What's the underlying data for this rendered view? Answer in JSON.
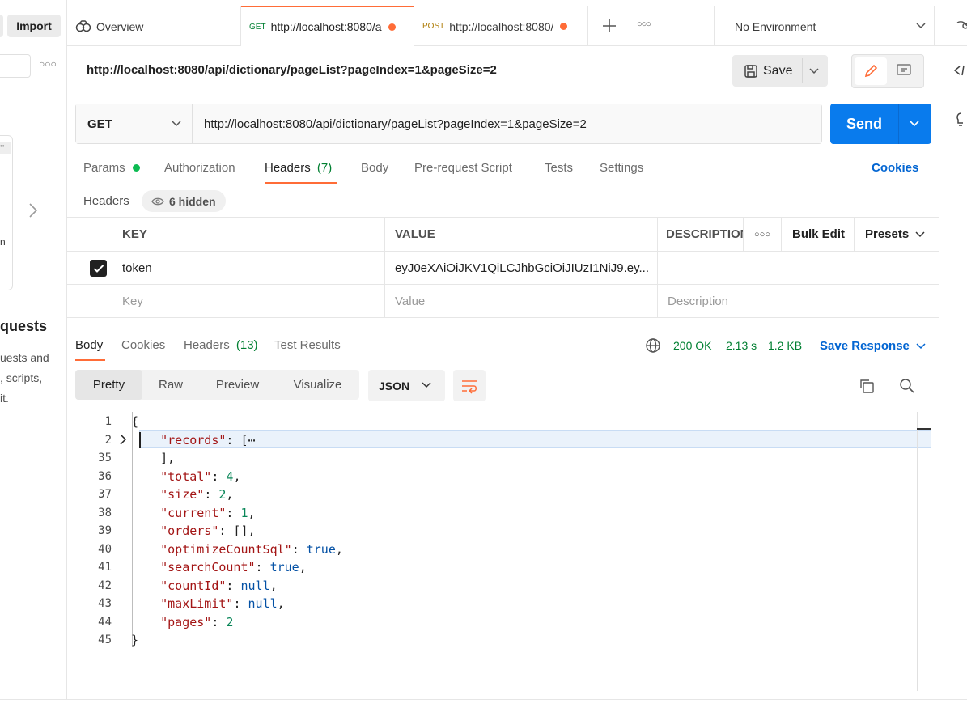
{
  "sidebar": {
    "import_label": "Import",
    "requests_heading": "quests",
    "requests_text_1": "uests and",
    "requests_text_2": ", scripts,",
    "requests_text_3": "it.",
    "stub_letter": "n"
  },
  "tabs": [
    {
      "label": "Overview",
      "icon": "overview-icon"
    },
    {
      "method": "GET",
      "label": "http://localhost:8080/a",
      "unsaved": true
    },
    {
      "method": "POST",
      "label": "http://localhost:8080/",
      "unsaved": true
    }
  ],
  "environment": {
    "selected": "No Environment"
  },
  "request": {
    "title": "http://localhost:8080/api/dictionary/pageList?pageIndex=1&pageSize=2",
    "save_label": "Save",
    "method": "GET",
    "url": "http://localhost:8080/api/dictionary/pageList?pageIndex=1&pageSize=2",
    "send_label": "Send"
  },
  "request_tabs": {
    "params": "Params",
    "authorization": "Authorization",
    "headers": "Headers",
    "headers_count": "(7)",
    "body": "Body",
    "prerequest": "Pre-request Script",
    "tests": "Tests",
    "settings": "Settings",
    "cookies": "Cookies"
  },
  "headers_section": {
    "label": "Headers",
    "hidden_label": "6 hidden",
    "col_key": "KEY",
    "col_value": "VALUE",
    "col_description": "DESCRIPTION",
    "bulk_edit": "Bulk Edit",
    "presets": "Presets",
    "rows": [
      {
        "key": "token",
        "value": "eyJ0eXAiOiJKV1QiLCJhbGciOiJIUzI1NiJ9.ey...",
        "checked": true
      }
    ],
    "placeholder_key": "Key",
    "placeholder_value": "Value",
    "placeholder_description": "Description"
  },
  "response": {
    "tabs": {
      "body": "Body",
      "cookies": "Cookies",
      "headers": "Headers",
      "headers_count": "(13)",
      "test_results": "Test Results"
    },
    "status": "200 OK",
    "time": "2.13 s",
    "size": "1.2 KB",
    "save_response": "Save Response",
    "view_modes": [
      "Pretty",
      "Raw",
      "Preview",
      "Visualize"
    ],
    "format": "JSON"
  },
  "code": {
    "lines": [
      {
        "num": "1",
        "parts": [
          [
            "p",
            "{"
          ]
        ]
      },
      {
        "num": "2",
        "parts": [
          [
            "p",
            "    "
          ],
          [
            "k",
            "\"records\""
          ],
          [
            "p",
            ": [⋯"
          ]
        ]
      },
      {
        "num": "35",
        "parts": [
          [
            "p",
            "    ],"
          ]
        ]
      },
      {
        "num": "36",
        "parts": [
          [
            "p",
            "    "
          ],
          [
            "k",
            "\"total\""
          ],
          [
            "p",
            ": "
          ],
          [
            "n",
            "4"
          ],
          [
            "p",
            ","
          ]
        ]
      },
      {
        "num": "37",
        "parts": [
          [
            "p",
            "    "
          ],
          [
            "k",
            "\"size\""
          ],
          [
            "p",
            ": "
          ],
          [
            "n",
            "2"
          ],
          [
            "p",
            ","
          ]
        ]
      },
      {
        "num": "38",
        "parts": [
          [
            "p",
            "    "
          ],
          [
            "k",
            "\"current\""
          ],
          [
            "p",
            ": "
          ],
          [
            "n",
            "1"
          ],
          [
            "p",
            ","
          ]
        ]
      },
      {
        "num": "39",
        "parts": [
          [
            "p",
            "    "
          ],
          [
            "k",
            "\"orders\""
          ],
          [
            "p",
            ": [],"
          ]
        ]
      },
      {
        "num": "40",
        "parts": [
          [
            "p",
            "    "
          ],
          [
            "k",
            "\"optimizeCountSql\""
          ],
          [
            "p",
            ": "
          ],
          [
            "b",
            "true"
          ],
          [
            "p",
            ","
          ]
        ]
      },
      {
        "num": "41",
        "parts": [
          [
            "p",
            "    "
          ],
          [
            "k",
            "\"searchCount\""
          ],
          [
            "p",
            ": "
          ],
          [
            "b",
            "true"
          ],
          [
            "p",
            ","
          ]
        ]
      },
      {
        "num": "42",
        "parts": [
          [
            "p",
            "    "
          ],
          [
            "k",
            "\"countId\""
          ],
          [
            "p",
            ": "
          ],
          [
            "b",
            "null"
          ],
          [
            "p",
            ","
          ]
        ]
      },
      {
        "num": "43",
        "parts": [
          [
            "p",
            "    "
          ],
          [
            "k",
            "\"maxLimit\""
          ],
          [
            "p",
            ": "
          ],
          [
            "b",
            "null"
          ],
          [
            "p",
            ","
          ]
        ]
      },
      {
        "num": "44",
        "parts": [
          [
            "p",
            "    "
          ],
          [
            "k",
            "\"pages\""
          ],
          [
            "p",
            ": "
          ],
          [
            "n",
            "2"
          ]
        ]
      },
      {
        "num": "45",
        "parts": [
          [
            "p",
            "}"
          ]
        ]
      }
    ]
  },
  "colors": {
    "accent": "#ff6c37",
    "send": "#097bed",
    "status_ok": "#007f31",
    "link": "#0265d2"
  }
}
